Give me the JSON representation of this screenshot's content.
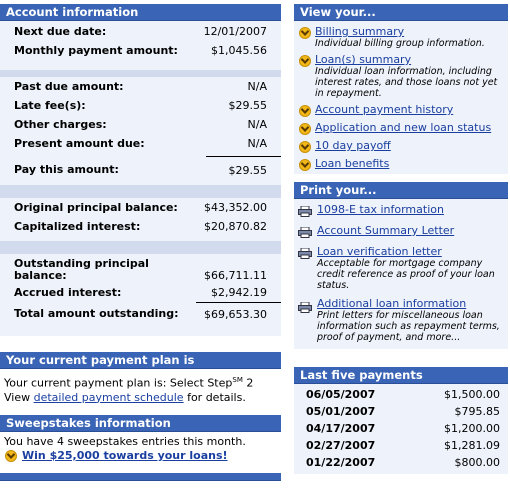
{
  "account": {
    "header": "Account information",
    "rows_a": [
      {
        "label": "Next due date:",
        "value": "12/01/2007"
      },
      {
        "label": "Monthly payment amount:",
        "value": "$1,045.56"
      }
    ],
    "rows_b": [
      {
        "label": "Past due amount:",
        "value": "N/A"
      },
      {
        "label": "Late fee(s):",
        "value": "$29.55"
      },
      {
        "label": "Other charges:",
        "value": "N/A"
      },
      {
        "label": "Present amount due:",
        "value": "N/A"
      }
    ],
    "pay_this": {
      "label": "Pay this amount:",
      "value": "$29.55"
    },
    "rows_c": [
      {
        "label": "Original principal balance:",
        "value": "$43,352.00"
      },
      {
        "label": "Capitalized interest:",
        "value": "$20,870.82"
      }
    ],
    "outstanding_label_1": "Outstanding principal",
    "outstanding_label_2": "balance:",
    "outstanding_value": "$66,711.11",
    "accrued": {
      "label": "Accrued interest:",
      "value": "$2,942.19"
    },
    "total": {
      "label": "Total amount outstanding:",
      "value": "$69,653.30"
    }
  },
  "plan": {
    "header": "Your current payment plan is",
    "line1_prefix": "Your current payment plan is: Select Step",
    "line1_sup": "SM",
    "line1_suffix": " 2",
    "line2_prefix": "View ",
    "line2_link": "detailed payment schedule",
    "line2_suffix": " for details."
  },
  "sweepstakes": {
    "header": "Sweepstakes information",
    "text": "You have 4 sweepstakes entries this month.",
    "link": "Win $25,000 towards your loans!"
  },
  "view": {
    "header": "View your...",
    "items": [
      {
        "label": "Billing summary",
        "desc": "Individual billing group information."
      },
      {
        "label": "Loan(s) summary",
        "desc": "Individual loan information, including interest rates, and those loans not yet in repayment."
      },
      {
        "label": "Account payment history",
        "desc": ""
      },
      {
        "label": "Application and new loan status",
        "desc": ""
      },
      {
        "label": "10 day payoff",
        "desc": ""
      },
      {
        "label": "Loan benefits",
        "desc": ""
      }
    ]
  },
  "print": {
    "header": "Print your...",
    "items": [
      {
        "label": "1098-E tax information",
        "desc": ""
      },
      {
        "label": "Account Summary Letter",
        "desc": ""
      },
      {
        "label": "Loan verification letter",
        "desc": "Acceptable for mortgage company credit reference as proof of your loan status."
      },
      {
        "label": "Additional loan information",
        "desc": "Print letters for miscellaneous loan information such as repayment terms, proof of payment, and more..."
      }
    ]
  },
  "payments": {
    "header": "Last five payments",
    "rows": [
      {
        "date": "06/05/2007",
        "amount": "$1,500.00"
      },
      {
        "date": "05/01/2007",
        "amount": "$795.85"
      },
      {
        "date": "04/17/2007",
        "amount": "$1,200.00"
      },
      {
        "date": "02/27/2007",
        "amount": "$1,281.09"
      },
      {
        "date": "01/22/2007",
        "amount": "$800.00"
      }
    ]
  },
  "colors": {
    "header_bg": "#3a64b5",
    "panel_bg": "#eef2fa",
    "link": "#1a3fa0",
    "bullet": "#f2b81a"
  }
}
